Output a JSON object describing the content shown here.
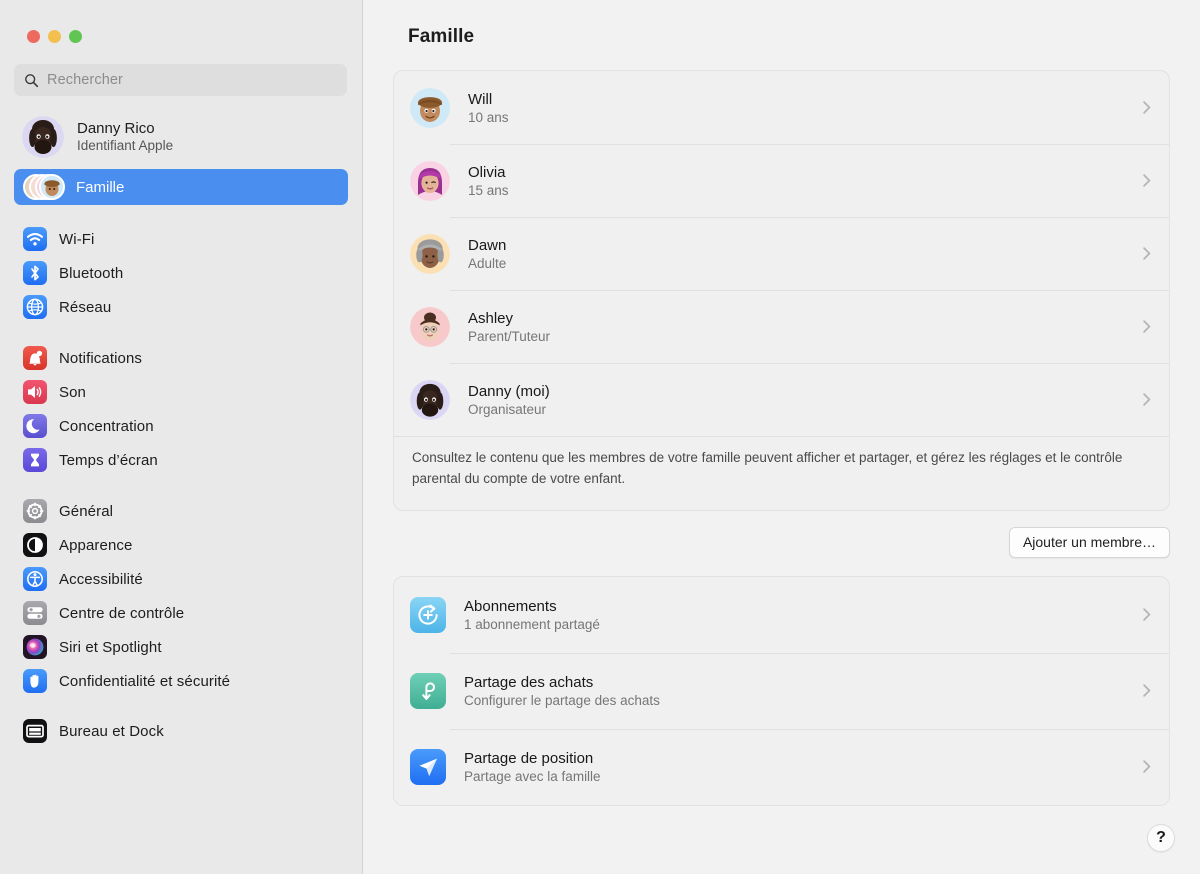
{
  "window": {
    "traffic_lights": [
      "close",
      "minimize",
      "zoom"
    ],
    "colors": {
      "close": "#ec6a5e",
      "minimize": "#f3bf4f",
      "zoom": "#61c554",
      "accent": "#4a8ef0",
      "sidebar_bg": "#e9e9e9",
      "main_bg": "#f2f2f2",
      "card_bg": "#f0f0f0"
    }
  },
  "sidebar": {
    "search": {
      "placeholder": "Rechercher",
      "value": ""
    },
    "profile": {
      "name": "Danny Rico",
      "subtitle": "Identifiant Apple"
    },
    "selected": {
      "label": "Famille",
      "icon": "family-avatars-icon"
    },
    "groups": [
      {
        "items": [
          {
            "label": "Wi-Fi",
            "icon": "wifi-icon",
            "color": "#2d7ff9"
          },
          {
            "label": "Bluetooth",
            "icon": "bluetooth-icon",
            "color": "#2d7ff9"
          },
          {
            "label": "Réseau",
            "icon": "network-globe-icon",
            "color": "#2d7ff9"
          }
        ]
      },
      {
        "items": [
          {
            "label": "Notifications",
            "icon": "bell-icon",
            "color": "#e8453c"
          },
          {
            "label": "Son",
            "icon": "speaker-icon",
            "color": "#e94b6b"
          },
          {
            "label": "Concentration",
            "icon": "moon-icon",
            "color": "#6a63d8"
          },
          {
            "label": "Temps d’écran",
            "icon": "hourglass-icon",
            "color": "#6a5ae0"
          }
        ]
      },
      {
        "items": [
          {
            "label": "Général",
            "icon": "gear-icon",
            "color": "#8e8e93"
          },
          {
            "label": "Apparence",
            "icon": "appearance-icon",
            "color": "#1c1c1e"
          },
          {
            "label": "Accessibilité",
            "icon": "accessibility-icon",
            "color": "#2d7ff9"
          },
          {
            "label": "Centre de contrôle",
            "icon": "control-center-icon",
            "color": "#8e8e93"
          },
          {
            "label": "Siri et Spotlight",
            "icon": "siri-icon",
            "color": "#2b1b2e"
          },
          {
            "label": "Confidentialité et sécurité",
            "icon": "hand-privacy-icon",
            "color": "#2d7ff9"
          }
        ]
      },
      {
        "items": [
          {
            "label": "Bureau et Dock",
            "icon": "desktop-dock-icon",
            "color": "#1c1c1e"
          }
        ]
      }
    ]
  },
  "main": {
    "title": "Famille",
    "members": [
      {
        "name": "Will",
        "role": "10 ans",
        "avatar_bg": "#cfe9f7",
        "chevron": "chevron-right-icon"
      },
      {
        "name": "Olivia",
        "role": "15 ans",
        "avatar_bg": "#f9d3e4",
        "chevron": "chevron-right-icon"
      },
      {
        "name": "Dawn",
        "role": "Adulte",
        "avatar_bg": "#fbe0b4",
        "chevron": "chevron-right-icon"
      },
      {
        "name": "Ashley",
        "role": "Parent/Tuteur",
        "avatar_bg": "#f8c9cb",
        "chevron": "chevron-right-icon"
      },
      {
        "name": "Danny  (moi)",
        "role": "Organisateur",
        "avatar_bg": "#dcd6f5",
        "chevron": "chevron-right-icon"
      }
    ],
    "note": "Consultez le contenu que les membres de votre famille peuvent afficher et partager, et gérez les réglages et le contrôle parental du compte de votre enfant.",
    "add_member_button": "Ajouter un membre…",
    "services": [
      {
        "name": "Abonnements",
        "sub": "1 abonnement partagé",
        "icon": "subscriptions-icon",
        "icon_color": "#5ec2ef",
        "chevron": "chevron-right-icon"
      },
      {
        "name": "Partage des achats",
        "sub": "Configurer le partage des achats",
        "icon": "purchase-sharing-icon",
        "icon_color": "#53bfa5",
        "chevron": "chevron-right-icon"
      },
      {
        "name": "Partage de position",
        "sub": "Partage avec la famille",
        "icon": "location-sharing-icon",
        "icon_color": "#2d7ff9",
        "chevron": "chevron-right-icon"
      }
    ],
    "help_button": "?"
  }
}
